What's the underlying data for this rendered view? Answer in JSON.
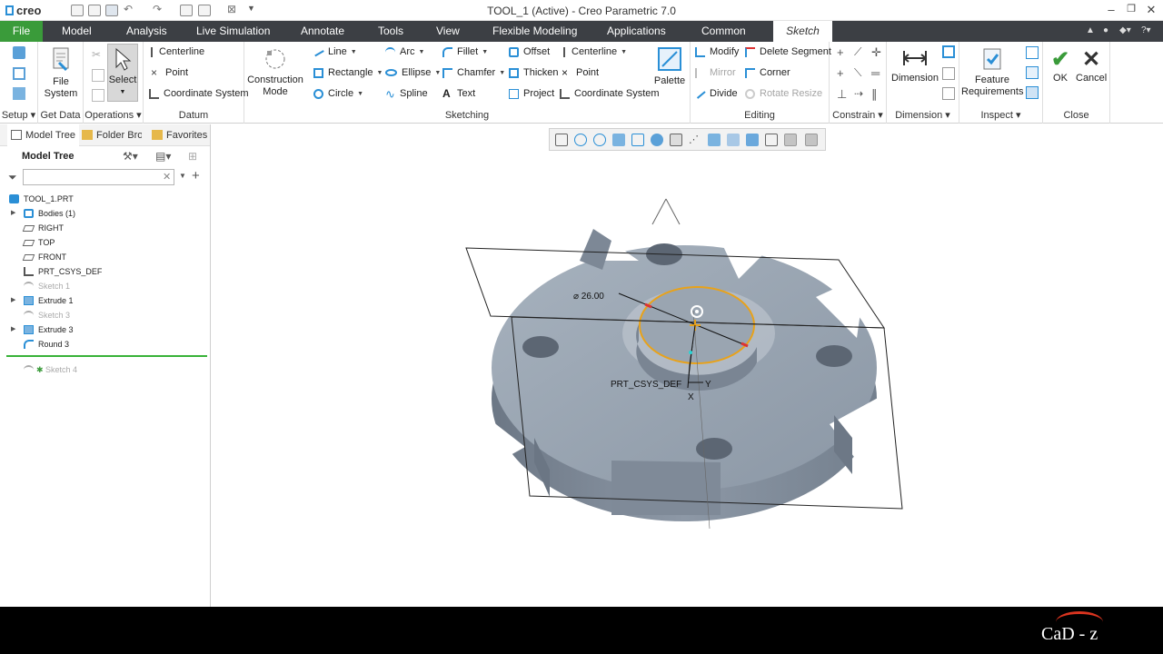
{
  "app": {
    "logo": "creo",
    "title": "TOOL_1 (Active) - Creo Parametric 7.0",
    "window_controls": [
      "–",
      "❐",
      "✕"
    ]
  },
  "menu": {
    "tabs": [
      "File",
      "Model",
      "Analysis",
      "Live Simulation",
      "Annotate",
      "Tools",
      "View",
      "Flexible Modeling",
      "Applications",
      "Common",
      "Sketch"
    ],
    "active": "Sketch"
  },
  "ribbon": {
    "setup": {
      "label": "Setup"
    },
    "get_data": {
      "file_system": "File System",
      "label": "Get Data"
    },
    "operations": {
      "select": "Select",
      "label": "Operations"
    },
    "datum": {
      "centerline": "Centerline",
      "point": "Point",
      "coordinate_system": "Coordinate System",
      "label": "Datum"
    },
    "sketching": {
      "construction_mode": "Construction Mode",
      "line": "Line",
      "rectangle": "Rectangle",
      "circle": "Circle",
      "arc": "Arc",
      "ellipse": "Ellipse",
      "spline": "Spline",
      "fillet": "Fillet",
      "chamfer": "Chamfer",
      "text": "Text",
      "offset": "Offset",
      "thicken": "Thicken",
      "project": "Project",
      "centerline": "Centerline",
      "point": "Point",
      "coordinate_system": "Coordinate System",
      "palette": "Palette",
      "label": "Sketching"
    },
    "editing": {
      "modify": "Modify",
      "mirror": "Mirror",
      "divide": "Divide",
      "delete_segment": "Delete Segment",
      "corner": "Corner",
      "rotate_resize": "Rotate Resize",
      "label": "Editing"
    },
    "constrain": {
      "label": "Constrain"
    },
    "dimension": {
      "dimension": "Dimension",
      "label": "Dimension"
    },
    "inspect": {
      "feature_requirements": "Feature Requirements",
      "label": "Inspect"
    },
    "close": {
      "ok": "OK",
      "cancel": "Cancel",
      "label": "Close"
    }
  },
  "left_panel": {
    "tabs": [
      "Model Tree",
      "Folder Bro",
      "Favorites"
    ],
    "tree_title": "Model Tree",
    "filter_value": "",
    "nodes": [
      {
        "label": "TOOL_1.PRT",
        "expandable": false,
        "dim": false,
        "icon": "part-icon"
      },
      {
        "label": "Bodies (1)",
        "expandable": true,
        "dim": false,
        "icon": "bodies-icon"
      },
      {
        "label": "RIGHT",
        "expandable": false,
        "dim": false,
        "icon": "datum-plane-icon"
      },
      {
        "label": "TOP",
        "expandable": false,
        "dim": false,
        "icon": "datum-plane-icon"
      },
      {
        "label": "FRONT",
        "expandable": false,
        "dim": false,
        "icon": "datum-plane-icon"
      },
      {
        "label": "PRT_CSYS_DEF",
        "expandable": false,
        "dim": false,
        "icon": "csys-icon"
      },
      {
        "label": "Sketch 1",
        "expandable": false,
        "dim": true,
        "icon": "sketch-icon"
      },
      {
        "label": "Extrude 1",
        "expandable": true,
        "dim": false,
        "icon": "extrude-icon"
      },
      {
        "label": "Sketch 3",
        "expandable": false,
        "dim": true,
        "icon": "sketch-icon"
      },
      {
        "label": "Extrude 3",
        "expandable": true,
        "dim": false,
        "icon": "extrude-icon"
      },
      {
        "label": "Round 3",
        "expandable": false,
        "dim": false,
        "icon": "round-icon"
      }
    ],
    "insert_node": {
      "label": "Sketch 4",
      "dim": true,
      "icon": "sketch-icon"
    }
  },
  "viewport": {
    "dimension_label": "⌀ 26.00",
    "csys_label": "PRT_CSYS_DEF",
    "axis_y": "Y",
    "axis_x": "X"
  },
  "footer": {
    "brand": "CaD - z"
  },
  "colors": {
    "menubar": "#3c3f44",
    "file_tab": "#3a9b3a",
    "accent": "#2a8fd6",
    "highlight": "#e8a21a",
    "part": "#8f9caa"
  }
}
